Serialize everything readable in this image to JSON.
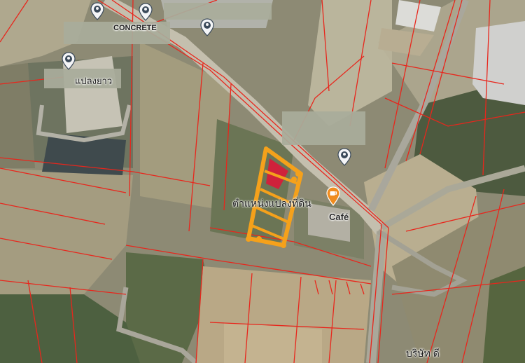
{
  "map": {
    "labels": {
      "concrete": "CONCRETE",
      "thai_plant": "แปลงยาว",
      "thai_center": "ตำแหน่งแปลงที่ดิน",
      "thai_company": "บริษัท ดี",
      "cafe": "Café"
    },
    "pins": [
      {
        "name": "map-pin-1",
        "icon": "location-pin-icon"
      },
      {
        "name": "map-pin-2",
        "icon": "location-pin-icon"
      },
      {
        "name": "map-pin-3",
        "icon": "location-pin-icon"
      },
      {
        "name": "map-pin-4",
        "icon": "location-pin-icon"
      },
      {
        "name": "map-pin-5",
        "icon": "location-pin-icon"
      }
    ],
    "cafe_icon": "cafe-icon",
    "colors": {
      "parcel_lines": "#e8261c",
      "highlight_parcel": "#f5a11b",
      "highlight_fill": "#e01437",
      "pin": "#3b4a5a",
      "cafe_pin": "#f08c1e",
      "redaction": "#a9ac9b"
    }
  }
}
